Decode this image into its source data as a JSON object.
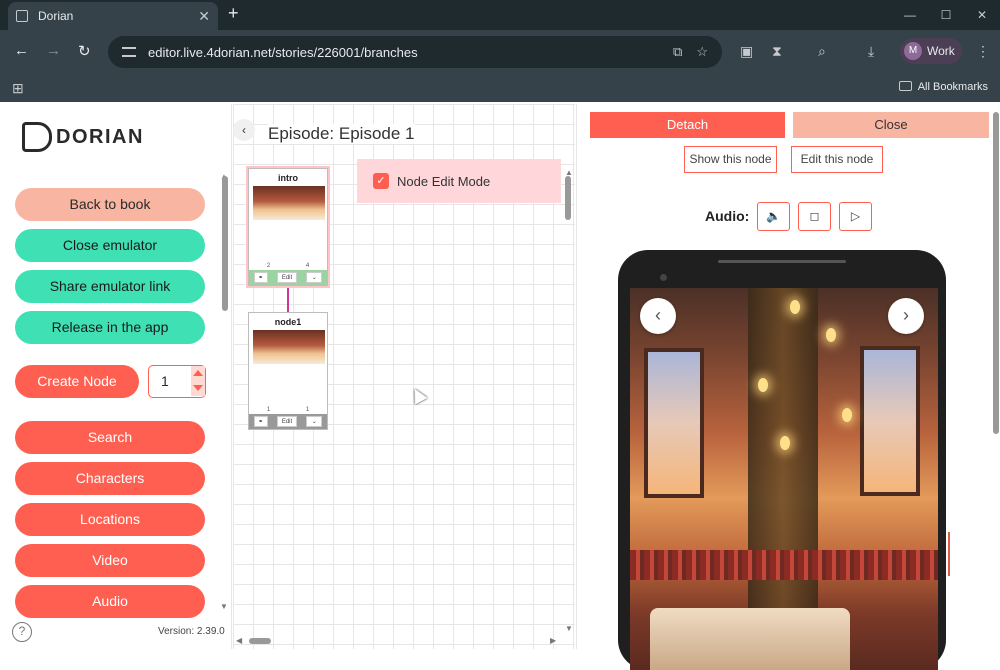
{
  "browser": {
    "tab_title": "Dorian",
    "url": "editor.live.4dorian.net/stories/226001/branches",
    "profile_initial": "M",
    "profile_label": "Work",
    "bookmarks_label": "All Bookmarks"
  },
  "sidebar": {
    "logo_text": "DORIAN",
    "buttons": [
      {
        "label": "Back to book"
      },
      {
        "label": "Close emulator"
      },
      {
        "label": "Share emulator link"
      },
      {
        "label": "Release in the app"
      }
    ],
    "create_node_label": "Create Node",
    "create_node_qty": "1",
    "menu": [
      {
        "label": "Search"
      },
      {
        "label": "Characters"
      },
      {
        "label": "Locations"
      },
      {
        "label": "Video"
      },
      {
        "label": "Audio"
      }
    ],
    "version": "Version: 2.39.0"
  },
  "graph": {
    "episode_title": "Episode: Episode 1",
    "edit_mode_label": "Node Edit Mode",
    "edit_mode_checked": true,
    "nodes": [
      {
        "name": "intro",
        "stat_left": "2",
        "stat_right": "4",
        "edit_label": "Edit"
      },
      {
        "name": "node1",
        "stat_left": "1",
        "stat_right": "1",
        "edit_label": "Edit"
      }
    ]
  },
  "panel": {
    "detach_label": "Detach",
    "close_label": "Close",
    "show_node_label": "Show this node",
    "edit_node_label": "Edit this node",
    "audio_label": "Audio:",
    "colors": {
      "accent": "#ff5f50",
      "peach": "#f8b5a1",
      "mint": "#3fe0b4"
    }
  }
}
